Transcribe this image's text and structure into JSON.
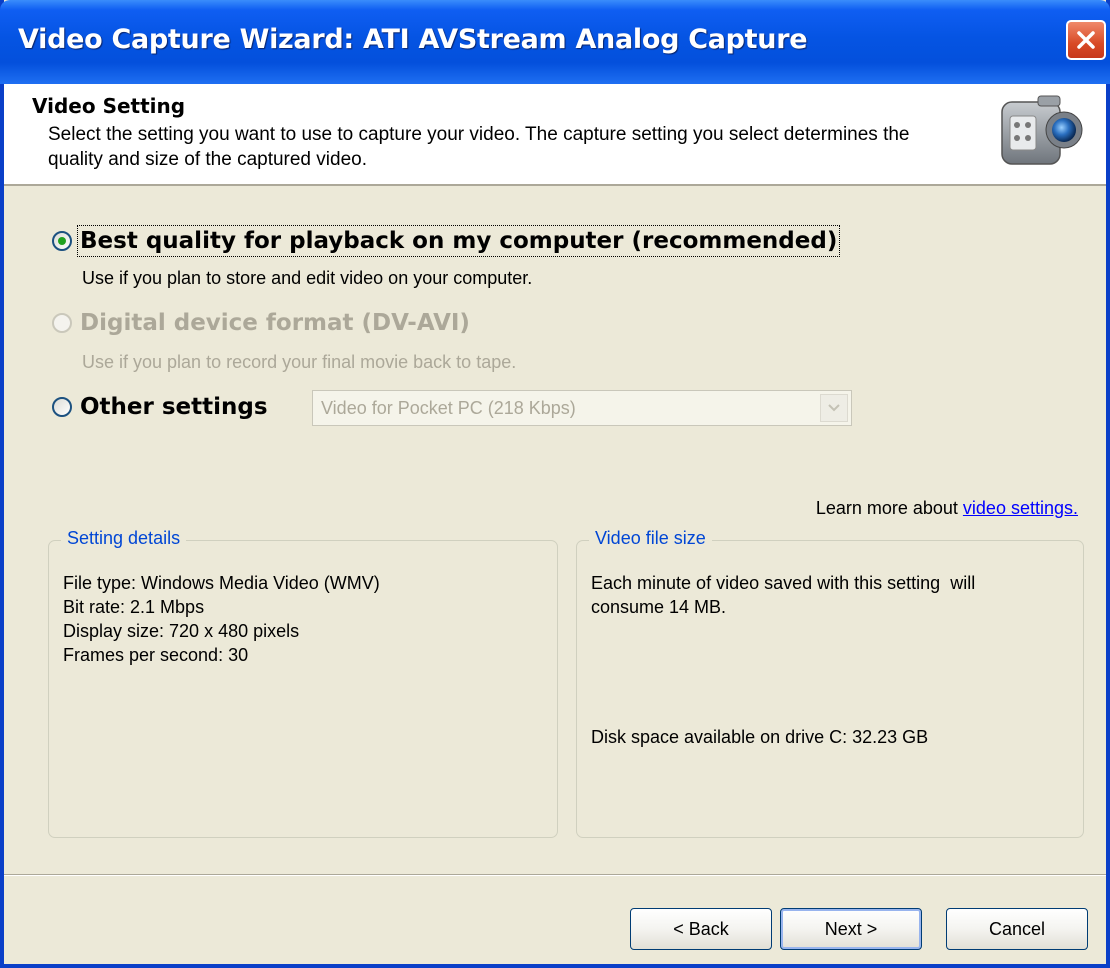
{
  "window": {
    "title": "Video Capture Wizard: ATI AVStream Analog Capture"
  },
  "header": {
    "title": "Video Setting",
    "description": "Select the setting you want to use to capture your video. The capture setting you select determines the quality and size of the captured video."
  },
  "options": {
    "best": {
      "label": "Best quality for playback on my computer (recommended)",
      "description": "Use if you plan to store and edit video on your computer.",
      "selected": true
    },
    "dv": {
      "label": "Digital device format (DV-AVI)",
      "description": "Use if you plan to record your final movie back to tape.",
      "enabled": false
    },
    "other": {
      "label": "Other settings",
      "dropdown_value": "Video for Pocket PC (218 Kbps)"
    }
  },
  "learn_more": {
    "prefix": "Learn more about ",
    "link": "video settings."
  },
  "setting_details": {
    "title": "Setting details",
    "lines": [
      "File type: Windows Media Video (WMV)",
      "Bit rate: 2.1 Mbps",
      "Display size: 720 x 480 pixels",
      "Frames per second: 30"
    ]
  },
  "file_size": {
    "title": "Video file size",
    "line1": "Each minute of video saved with this setting  will",
    "line2": "consume 14 MB.",
    "disk": "Disk space available on drive C: 32.23 GB"
  },
  "buttons": {
    "back": "< Back",
    "next": "Next >",
    "cancel": "Cancel"
  },
  "colors": {
    "titlebar": "#0554e3",
    "accent_link": "#0000ff",
    "group_label": "#0046d5"
  }
}
